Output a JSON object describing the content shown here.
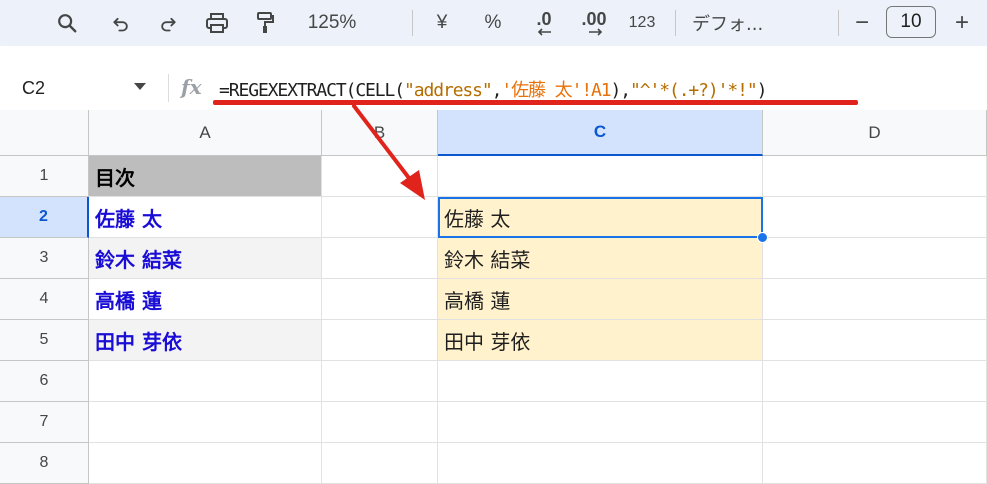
{
  "toolbar": {
    "zoom": "125%",
    "currency_symbol": "¥",
    "percent_symbol": "%",
    "decrease_decimal": ".0",
    "increase_decimal": ".00",
    "number_format": "123",
    "font_name": "デフォ...",
    "font_size": "10",
    "minus": "−",
    "plus": "+"
  },
  "formula_bar": {
    "cell_ref": "C2",
    "fx": "fx",
    "formula_parts": {
      "p1": "=REGEXEXTRACT(CELL(",
      "p2": "\"address\"",
      "p3": ",",
      "p4": "'佐藤 太'!A1",
      "p5": "),",
      "p6": "\"^'*(.+?)'*!\"",
      "p7": ")"
    },
    "underline_color": "#e0241b"
  },
  "sheet": {
    "columns": [
      "A",
      "B",
      "C",
      "D"
    ],
    "selected_column": "C",
    "rows": [
      "1",
      "2",
      "3",
      "4",
      "5",
      "6",
      "7",
      "8"
    ],
    "selected_row": "2",
    "a1": "目次",
    "toc_links": [
      "佐藤 太",
      "鈴木 結菜",
      "高橋 蓮",
      "田中 芽依"
    ],
    "results": [
      "佐藤 太",
      "鈴木 結菜",
      "高橋 蓮",
      "田中 芽依"
    ]
  },
  "colors": {
    "accent": "#1a73e8",
    "link": "#1a0dd6",
    "result_fill": "#fff2cc",
    "header_fill": "#bdbdbd",
    "arrow": "#e0241b"
  }
}
